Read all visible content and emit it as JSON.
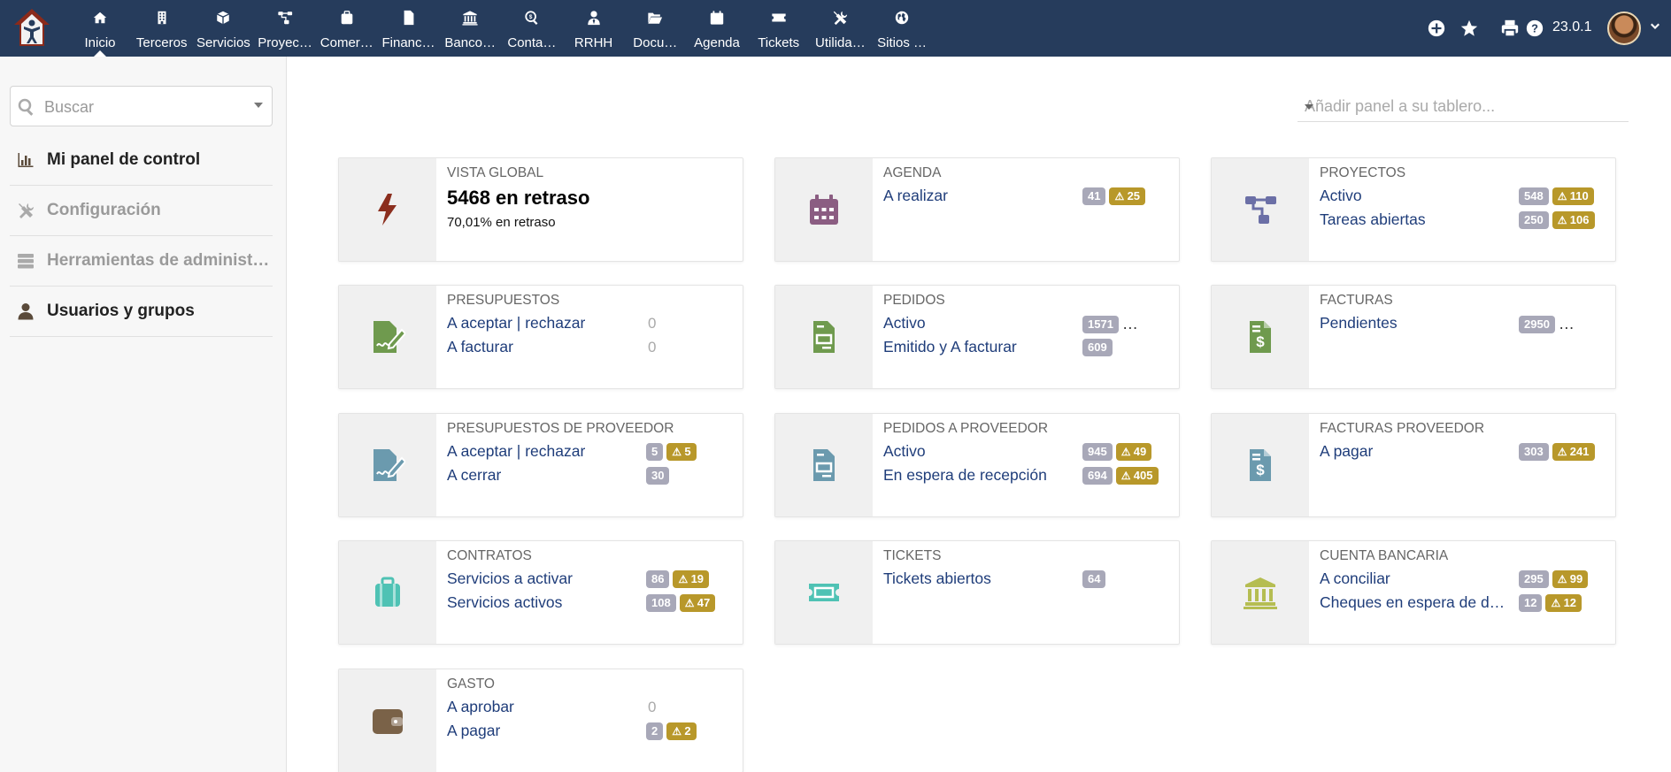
{
  "nav": {
    "items": [
      {
        "label": "Inicio",
        "icon": "home-icon",
        "active": true
      },
      {
        "label": "Terceros",
        "icon": "building-icon"
      },
      {
        "label": "Servicios",
        "icon": "cube-icon"
      },
      {
        "label": "Proyec…",
        "icon": "sitemap-icon"
      },
      {
        "label": "Comer…",
        "icon": "suitcase-icon"
      },
      {
        "label": "Financ…",
        "icon": "file-dollar-icon"
      },
      {
        "label": "Banco…",
        "icon": "bank-icon"
      },
      {
        "label": "Conta…",
        "icon": "search-dollar-icon"
      },
      {
        "label": "RRHH",
        "icon": "user-tie-icon"
      },
      {
        "label": "Docu…",
        "icon": "folder-open-icon"
      },
      {
        "label": "Agenda",
        "icon": "calendar-icon"
      },
      {
        "label": "Tickets",
        "icon": "ticket-icon"
      },
      {
        "label": "Utilida…",
        "icon": "tools-icon"
      },
      {
        "label": "Sitios …",
        "icon": "globe-icon"
      }
    ]
  },
  "topright": {
    "version": "23.0.1"
  },
  "sidebar": {
    "search_placeholder": "Buscar",
    "items": [
      {
        "label": "Mi panel de control",
        "icon": "chart-bar-icon",
        "color": "#222222"
      },
      {
        "label": "Configuración",
        "icon": "tools-icon",
        "color": "#9a9a9a"
      },
      {
        "label": "Herramientas de administ…",
        "icon": "server-icon",
        "color": "#9a9a9a"
      },
      {
        "label": "Usuarios y grupos",
        "icon": "user-icon",
        "color": "#222222"
      }
    ]
  },
  "main": {
    "add_panel_placeholder": "Añadir panel a su tablero...",
    "global": {
      "title": "VISTA GLOBAL",
      "count": "5468 en retraso",
      "percent": "70,01% en retraso",
      "icon_color": "#8b2e1e"
    },
    "cards": [
      {
        "title": "AGENDA",
        "icon": "calendar-icon",
        "icon_color": "#8b5d82",
        "rows": [
          {
            "label": "A realizar",
            "count": "41",
            "warn": "25"
          }
        ]
      },
      {
        "title": "PROYECTOS",
        "icon": "sitemap-icon",
        "icon_color": "#6b6fa6",
        "rows": [
          {
            "label": "Activo",
            "count": "548",
            "warn": "110"
          },
          {
            "label": "Tareas abiertas",
            "count": "250",
            "warn": "106"
          }
        ]
      },
      {
        "title": "PRESUPUESTOS",
        "icon": "file-signature-icon",
        "icon_color": "#6f9a4e",
        "rows": [
          {
            "label": "A aceptar | rechazar",
            "zero": "0"
          },
          {
            "label": "A facturar",
            "zero": "0"
          }
        ]
      },
      {
        "title": "PEDIDOS",
        "icon": "file-invoice-icon",
        "icon_color": "#6f9a4e",
        "rows": [
          {
            "label": "Activo",
            "count": "1571",
            "more": "…"
          },
          {
            "label": "Emitido y A facturar",
            "count": "609"
          }
        ]
      },
      {
        "title": "FACTURAS",
        "icon": "file-dollar-icon",
        "icon_color": "#6f9a4e",
        "rows": [
          {
            "label": "Pendientes",
            "count": "2950",
            "more": "…"
          }
        ]
      },
      {
        "title": "PRESUPUESTOS DE PROVEEDOR",
        "icon": "file-signature-icon",
        "icon_color": "#6b9aae",
        "rows": [
          {
            "label": "A aceptar | rechazar",
            "count": "5",
            "warn": "5"
          },
          {
            "label": "A cerrar",
            "count": "30"
          }
        ]
      },
      {
        "title": "PEDIDOS A PROVEEDOR",
        "icon": "file-invoice-icon",
        "icon_color": "#6b9aae",
        "rows": [
          {
            "label": "Activo",
            "count": "945",
            "warn": "49"
          },
          {
            "label": "En espera de recepción",
            "count": "694",
            "warn": "405"
          }
        ]
      },
      {
        "title": "FACTURAS PROVEEDOR",
        "icon": "file-dollar-icon",
        "icon_color": "#6b9aae",
        "rows": [
          {
            "label": "A pagar",
            "count": "303",
            "warn": "241"
          }
        ]
      },
      {
        "title": "CONTRATOS",
        "icon": "suitcase-icon",
        "icon_color": "#4fc2b4",
        "rows": [
          {
            "label": "Servicios a activar",
            "count": "86",
            "warn": "19"
          },
          {
            "label": "Servicios activos",
            "count": "108",
            "warn": "47"
          }
        ]
      },
      {
        "title": "TICKETS",
        "icon": "ticket-icon",
        "icon_color": "#4fc2b4",
        "rows": [
          {
            "label": "Tickets abiertos",
            "count": "64"
          }
        ]
      },
      {
        "title": "CUENTA BANCARIA",
        "icon": "bank-icon",
        "icon_color": "#b5bd52",
        "rows": [
          {
            "label": "A conciliar",
            "count": "295",
            "warn": "99"
          },
          {
            "label": "Cheques en espera de d…",
            "count": "12",
            "warn": "12"
          }
        ]
      },
      {
        "title": "GASTO",
        "icon": "wallet-icon",
        "icon_color": "#7a6248",
        "rows": [
          {
            "label": "A aprobar",
            "zero": "0"
          },
          {
            "label": "A pagar",
            "count": "2",
            "warn": "2"
          }
        ]
      }
    ]
  }
}
